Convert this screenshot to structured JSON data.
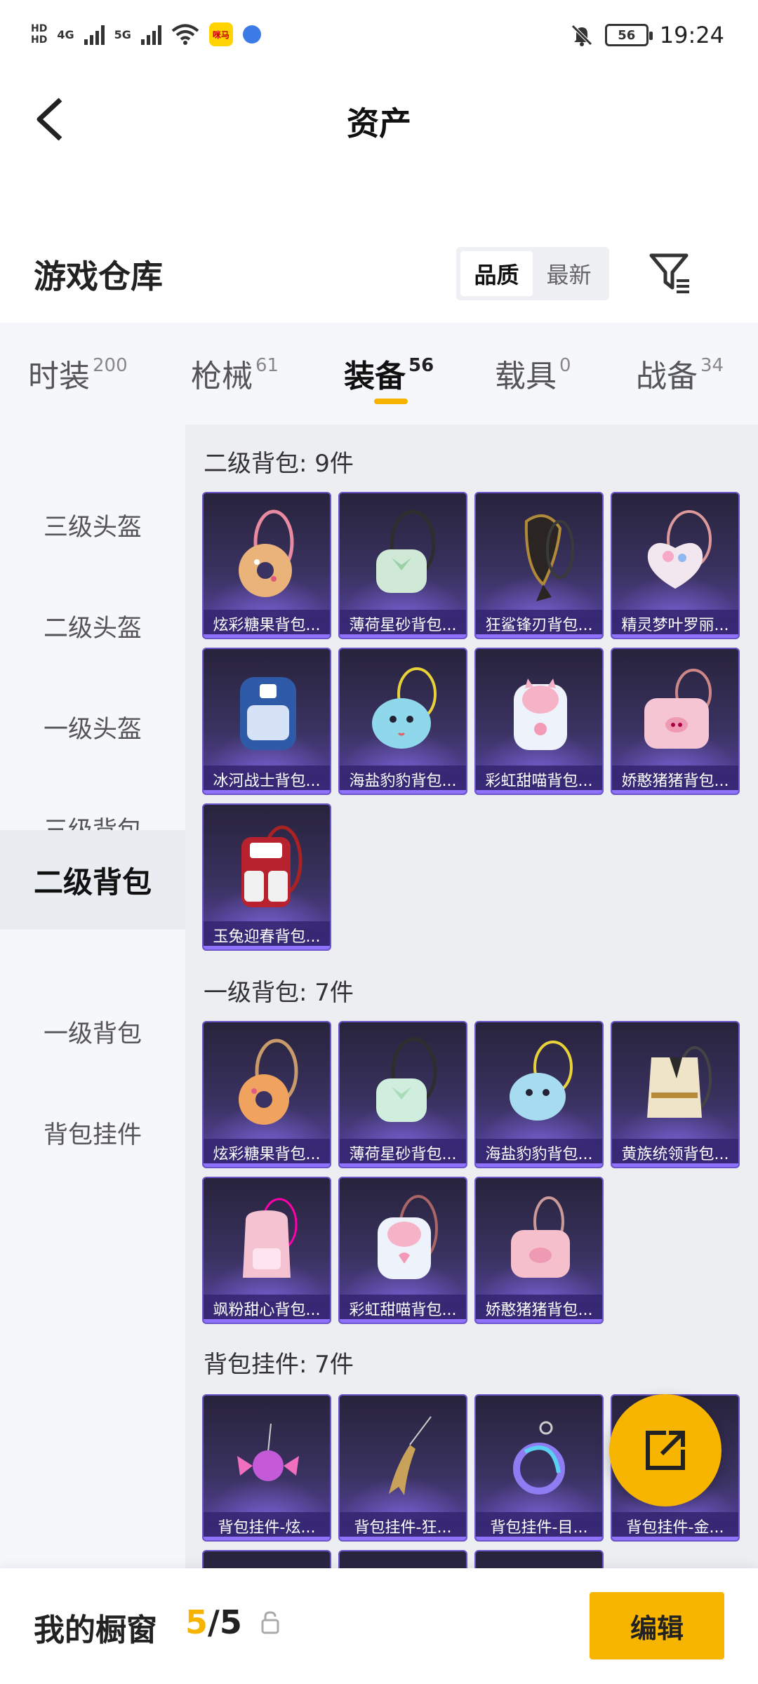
{
  "status_bar": {
    "hd_top": "HD",
    "hd_bottom": "HD",
    "net1": "4G",
    "net2": "5G",
    "app_badge": "咪马",
    "battery": "56",
    "time": "19:24"
  },
  "header": {
    "title": "资产"
  },
  "warehouse": {
    "title": "游戏仓库",
    "sort_options": [
      "品质",
      "最新"
    ],
    "active_sort": "品质"
  },
  "tabs": [
    {
      "label": "时装",
      "count": "200"
    },
    {
      "label": "枪械",
      "count": "61"
    },
    {
      "label": "装备",
      "count": "56",
      "active": true
    },
    {
      "label": "载具",
      "count": "0"
    },
    {
      "label": "战备",
      "count": "34"
    }
  ],
  "sidebar": {
    "items": [
      "三级头盔",
      "二级头盔",
      "一级头盔",
      "三级背包",
      "二级背包",
      "一级背包",
      "背包挂件"
    ],
    "active": "二级背包"
  },
  "sections": [
    {
      "title": "二级背包: 9件",
      "items": [
        "炫彩糖果背包...",
        "薄荷星砂背包...",
        "狂鲨锋刃背包...",
        "精灵梦叶罗丽...",
        "冰河战士背包...",
        "海盐豹豹背包...",
        "彩虹甜喵背包...",
        "娇憨猪猪背包...",
        "玉兔迎春背包..."
      ]
    },
    {
      "title": "一级背包: 7件",
      "items": [
        "炫彩糖果背包...",
        "薄荷星砂背包...",
        "海盐豹豹背包...",
        "黄族统领背包...",
        "飒粉甜心背包...",
        "彩虹甜喵背包...",
        "娇憨猪猪背包..."
      ]
    },
    {
      "title": "背包挂件: 7件",
      "items": [
        "背包挂件-炫...",
        "背包挂件-狂...",
        "背包挂件-目...",
        "背包挂件-金..."
      ]
    }
  ],
  "bottom_bar": {
    "label": "我的橱窗",
    "count_current": "5",
    "count_sep": "/",
    "count_total": "5",
    "edit_label": "编辑"
  },
  "colors": {
    "accent": "#f7b500",
    "card_top": "#28233c",
    "card_bottom": "#5845a8"
  }
}
